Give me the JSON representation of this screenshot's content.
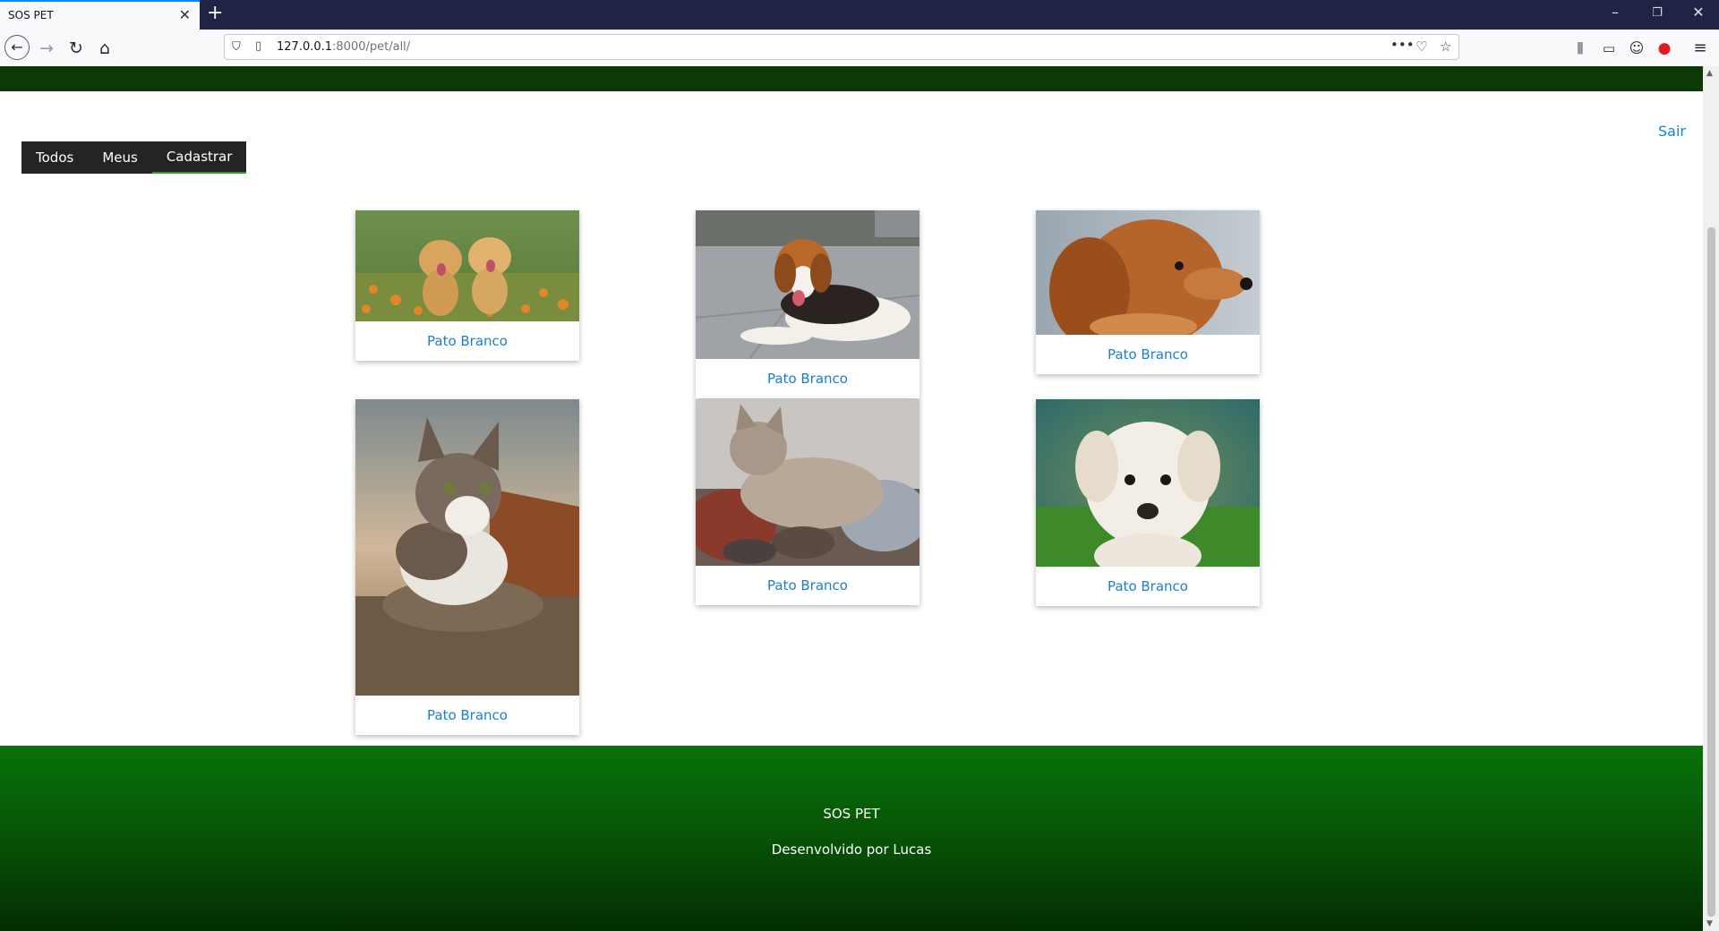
{
  "browser": {
    "tab_title": "SOS PET",
    "url_host": "127.0.0.1",
    "url_path": ":8000/pet/all/"
  },
  "header": {
    "logout_label": "Sair"
  },
  "menu": {
    "items": [
      {
        "label": "Todos"
      },
      {
        "label": "Meus"
      },
      {
        "label": "Cadastrar"
      }
    ]
  },
  "pets": [
    {
      "city": "Pato Branco",
      "image": "two golden retriever puppies"
    },
    {
      "city": "Pato Branco",
      "image": "beagle lying on floor"
    },
    {
      "city": "Pato Branco",
      "image": "brown dog profile"
    },
    {
      "city": "Pato Branco",
      "image": "tabby and white cat on rock"
    },
    {
      "city": "Pato Branco",
      "image": "cat with kittens on blanket"
    },
    {
      "city": "Pato Branco",
      "image": "white puppy"
    }
  ],
  "footer": {
    "title": "SOS PET",
    "credit": "Desenvolvido por Lucas"
  },
  "colors": {
    "top_strip": "#0b3a07",
    "footer_green": "#097309",
    "link": "#1a7fd1",
    "menu_bg": "#222426"
  }
}
